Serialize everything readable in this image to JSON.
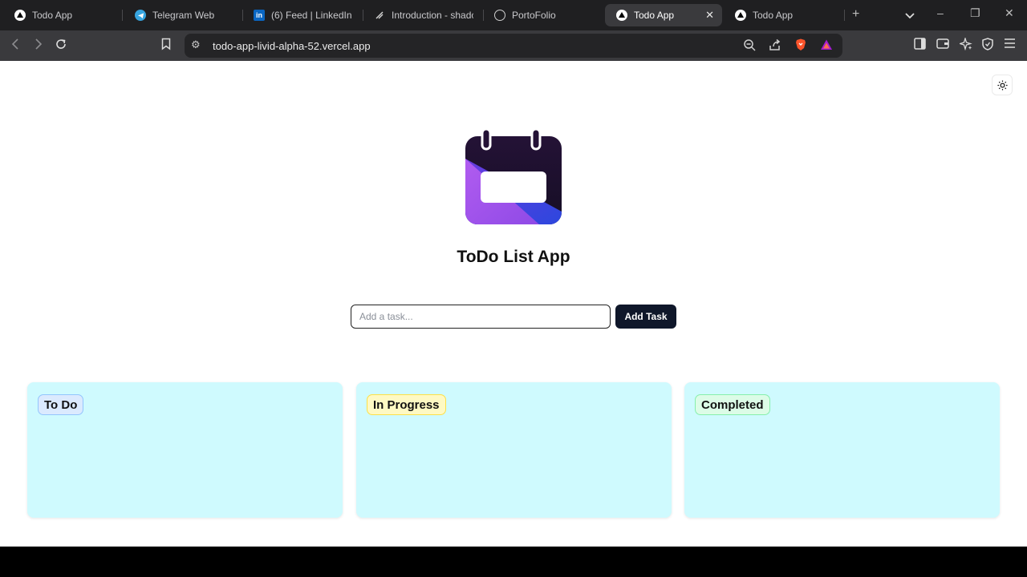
{
  "browser": {
    "tabs": [
      {
        "title": "Todo App",
        "icon": "vercel-icon"
      },
      {
        "title": "Telegram Web",
        "icon": "telegram-icon"
      },
      {
        "title": "(6) Feed | LinkedIn",
        "icon": "linkedin-icon"
      },
      {
        "title": "Introduction - shadc",
        "icon": "shadcn-icon"
      },
      {
        "title": "PortoFolio",
        "icon": "globe-icon"
      },
      {
        "title": "Todo App",
        "icon": "vercel-icon",
        "active": true
      },
      {
        "title": "Todo App",
        "icon": "vercel-icon"
      }
    ],
    "url": "todo-app-livid-alpha-52.vercel.app"
  },
  "app": {
    "title": "ToDo List App",
    "input_placeholder": "Add a task...",
    "add_button": "Add Task",
    "columns": [
      {
        "label": "To Do",
        "color": "#dbeafe"
      },
      {
        "label": "In Progress",
        "color": "#fef9c3"
      },
      {
        "label": "Completed",
        "color": "#dcfce7"
      }
    ],
    "column_background": "#cffafe",
    "button_color": "#0f172a"
  }
}
